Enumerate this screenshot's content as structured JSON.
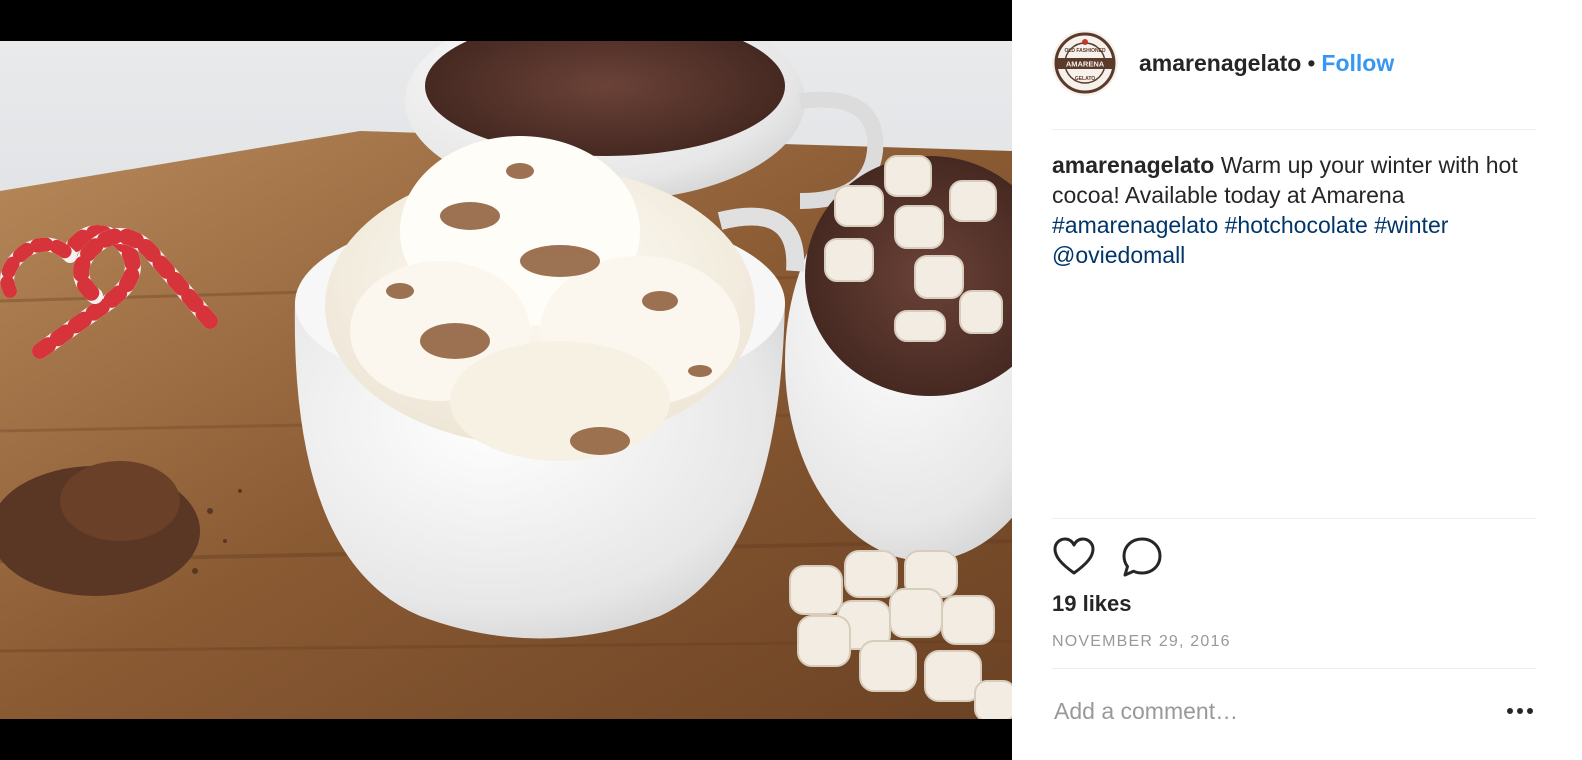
{
  "post": {
    "image_alt": "Hot cocoa with whipped cream and cinnamon, mugs of hot chocolate with marshmallows, candy canes and cocoa powder on a wooden board"
  },
  "header": {
    "username": "amarenagelato",
    "separator": "•",
    "follow_label": "Follow",
    "avatar_logo": {
      "top_text": "OLD FASHIONED",
      "main_text": "AMARENA",
      "bottom_text": "GELATO"
    }
  },
  "caption": {
    "username": "amarenagelato",
    "text": "Warm up your winter with hot cocoa! Available today at Amarena",
    "tags": [
      "#amarenagelato",
      "#hotchocolate",
      "#winter"
    ],
    "mention": "@oviedomall"
  },
  "actions": {
    "like_icon": "heart-icon",
    "comment_icon": "comment-icon"
  },
  "likes_text": "19 likes",
  "date_text": "NOVEMBER 29, 2016",
  "comment": {
    "placeholder": "Add a comment…",
    "more_icon": "more-options-icon"
  },
  "colors": {
    "follow": "#3897f0",
    "tag": "#003569",
    "muted": "#999999",
    "divider": "#efefef"
  }
}
